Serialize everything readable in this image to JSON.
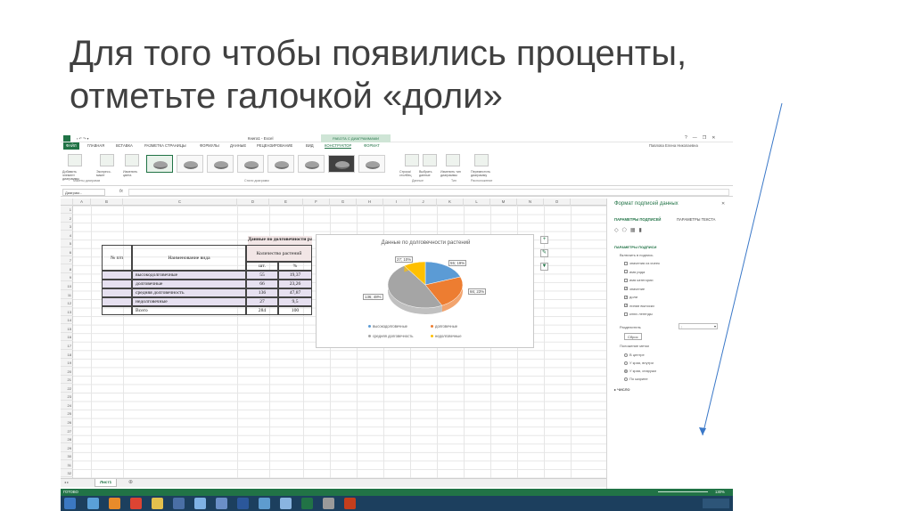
{
  "slide": {
    "title_line1": "Для того чтобы появились проценты,",
    "title_line2": "отметьте галочкой «доли»"
  },
  "excel": {
    "window_title": "Книга1 - Excel",
    "context_band": "РАБОТА С ДИАГРАММАМИ",
    "user": "Павлова Елена Николаевна",
    "win_controls": [
      "?",
      "—",
      "❐",
      "✕"
    ],
    "tabs": [
      "ФАЙЛ",
      "ГЛАВНАЯ",
      "ВСТАВКА",
      "РАЗМЕТКА СТРАНИЦЫ",
      "ФОРМУЛЫ",
      "ДАННЫЕ",
      "РЕЦЕНЗИРОВАНИЕ",
      "ВИД",
      "КОНСТРУКТОР",
      "ФОРМАТ"
    ],
    "ribbon": {
      "btn_add_element": "Добавить элемент диаграммы",
      "btn_express": "Экспресс-макет",
      "btn_colors": "Изменить цвета",
      "group_layouts": "Макеты диаграмм",
      "group_styles": "Стили диаграмм",
      "btn_row_col": "Строка/столбец",
      "btn_select_data": "Выбрать данные",
      "group_data": "Данные",
      "btn_change_type": "Изменить тип диаграммы",
      "group_type": "Тип",
      "btn_move": "Переместить диаграмму",
      "group_location": "Расположение"
    },
    "name_box": "Диаграм...",
    "fx": "fx",
    "columns": [
      "A",
      "B",
      "C",
      "D",
      "E",
      "F",
      "G",
      "H",
      "I",
      "J",
      "K",
      "L",
      "M",
      "N",
      "O"
    ],
    "rows": [
      "1",
      "2",
      "3",
      "4",
      "5",
      "6",
      "7",
      "8",
      "9",
      "10",
      "11",
      "12",
      "13",
      "14",
      "15",
      "16",
      "17",
      "18",
      "19",
      "20",
      "21",
      "22",
      "23",
      "24",
      "25",
      "26",
      "27",
      "28",
      "29",
      "30",
      "31",
      "32"
    ],
    "table": {
      "title": "Данные по долговечности растений",
      "col_num": "№ п/п",
      "col_name": "Наименование вида",
      "col_qty": "Количество растений",
      "col_pcs": "шт.",
      "col_pct": "%",
      "rows": [
        {
          "name": "высокодолговечные",
          "pcs": "55",
          "pct": "19,37"
        },
        {
          "name": "долговечные",
          "pcs": "66",
          "pct": "23,26"
        },
        {
          "name": "средняя долговечность",
          "pcs": "136",
          "pct": "47,87"
        },
        {
          "name": "недолговечные",
          "pcs": "27",
          "pct": "9,5"
        }
      ],
      "total_label": "Всего",
      "total_pcs": "284",
      "total_pct": "100"
    },
    "sheet_tab": "Лист1",
    "status_ready": "ГОТОВО",
    "zoom": "130%"
  },
  "chart_data": {
    "type": "pie",
    "title": "Данные по долговечности растений",
    "categories": [
      "высокодолговечные",
      "долговечные",
      "средняя долговечность",
      "недолговечные"
    ],
    "values": [
      55,
      66,
      136,
      27
    ],
    "data_labels": [
      "55; 19%",
      "66; 23%",
      "136; 48%",
      "27; 10%"
    ],
    "colors": [
      "#5b9bd5",
      "#ed7d31",
      "#a5a5a5",
      "#ffc000"
    ],
    "legend_position": "bottom"
  },
  "format_pane": {
    "title": "Формат подписей данных",
    "tab_label_params": "ПАРАМЕТРЫ ПОДПИСЕЙ",
    "tab_text_params": "ПАРАМЕТРЫ ТЕКСТА",
    "section": "ПАРАМЕТРЫ ПОДПИСИ",
    "include_caption": "Включить в подпись",
    "checks": [
      {
        "label": "значения из ячеек",
        "checked": false
      },
      {
        "label": "имя ряда",
        "checked": false
      },
      {
        "label": "имя категории",
        "checked": false
      },
      {
        "label": "значение",
        "checked": true
      },
      {
        "label": "доли",
        "checked": true
      },
      {
        "label": "линии выноски",
        "checked": true
      },
      {
        "label": "ключ легенды",
        "checked": false
      }
    ],
    "separator_label": "Разделитель",
    "separator_value": ";",
    "reset_button": "Сброс",
    "position_label": "Положение метки",
    "positions": [
      {
        "label": "В центре",
        "on": false
      },
      {
        "label": "У края, внутри",
        "on": false
      },
      {
        "label": "У края, снаружи",
        "on": true
      },
      {
        "label": "По ширине",
        "on": false
      }
    ],
    "number_section": "ЧИСЛО"
  },
  "arrow_color": "#3a78c8"
}
